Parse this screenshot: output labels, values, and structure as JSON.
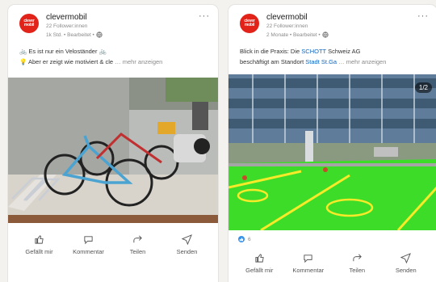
{
  "colors": {
    "brand": "#e2231a",
    "link": "#0a66c2",
    "court_green": "#3cdc29",
    "court_line": "#f7ea29"
  },
  "post1": {
    "author": "clevermobil",
    "avatar_text": "clever mobil",
    "followers": "22 Follower:innen",
    "meta": "1k Std. • Bearbeitet •",
    "line1": "🚲 Es ist nur ein Veloständer 🚲",
    "line2": "💡 Aber er zeigt wie motiviert & cle",
    "more": "… mehr anzeigen",
    "options": "···"
  },
  "post2": {
    "author": "clevermobil",
    "avatar_text": "clever mobil",
    "followers": "22 Follower:innen",
    "meta": "2 Monate • Bearbeitet •",
    "line1_pre": "Blick in die Praxis: Die ",
    "line1_link": "SCHOTT",
    "line1_post": " Schweiz AG",
    "line2_pre": "beschäftigt am Standort ",
    "line2_link": "Stadt St.Ga",
    "more": "… mehr anzeigen",
    "counter": "1/2",
    "reaction_count": "6",
    "options": "···"
  },
  "actions": [
    "Gefällt mir",
    "Kommentar",
    "Teilen",
    "Senden"
  ],
  "icons": [
    "like-icon",
    "comment-icon",
    "share-icon",
    "send-icon",
    "globe-icon",
    "more-options-icon"
  ]
}
